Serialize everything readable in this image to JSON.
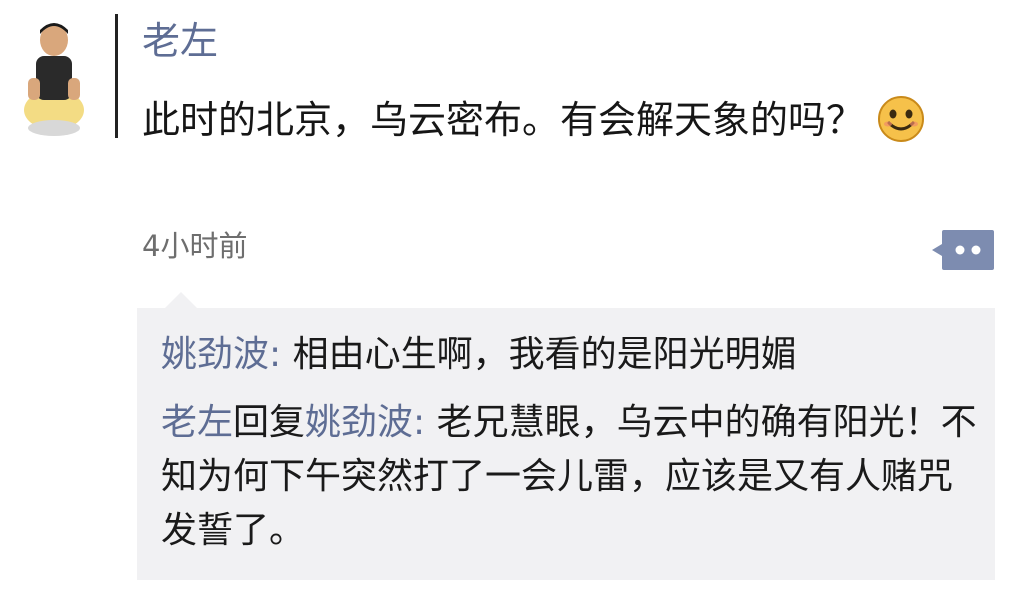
{
  "post": {
    "author": "老左",
    "text": "此时的北京，乌云密布。有会解天象的吗？",
    "emoji": "smile-emoji",
    "time": "4小时前",
    "more_icon": "comment-more-icon"
  },
  "comments": [
    {
      "author": "姚劲波",
      "sep": ": ",
      "text": "相由心生啊，我看的是阳光明媚"
    },
    {
      "author": "老左",
      "reply_word": "回复",
      "reply_to": "姚劲波",
      "sep": ": ",
      "text": "老兄慧眼，乌云中的确有阳光！不知为何下午突然打了一会儿雷，应该是又有人赌咒发誓了。"
    }
  ],
  "colors": {
    "name": "#5e6d94",
    "comment_bg": "#f1f1f3",
    "more_button": "#7d8cb0"
  }
}
